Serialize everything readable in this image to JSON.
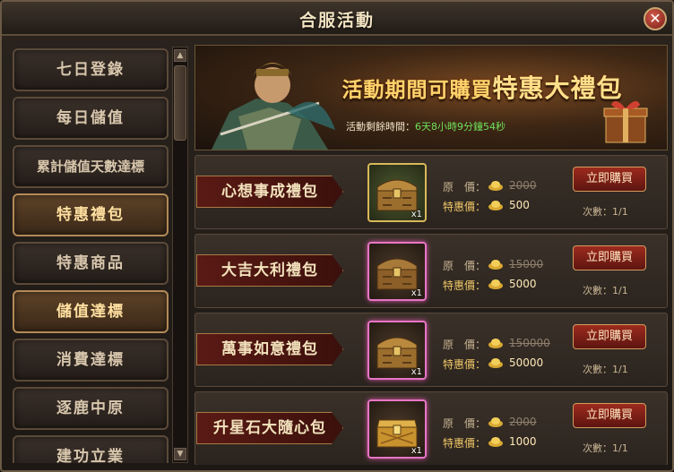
{
  "window": {
    "title": "合服活動"
  },
  "sidebar": {
    "items": [
      {
        "label": "七日登錄",
        "active": false
      },
      {
        "label": "每日儲值",
        "active": false
      },
      {
        "label": "累計儲值天數達標",
        "active": false
      },
      {
        "label": "特惠禮包",
        "active": true
      },
      {
        "label": "特惠商品",
        "active": false
      },
      {
        "label": "儲值達標",
        "active": true
      },
      {
        "label": "消費達標",
        "active": false
      },
      {
        "label": "逐鹿中原",
        "active": false
      },
      {
        "label": "建功立業",
        "active": false
      }
    ]
  },
  "banner": {
    "headline_prefix": "活動期間可購買",
    "headline_main": "特惠大禮包",
    "countdown_label": "活動剩餘時間：",
    "countdown_value": "6天8小時9分鐘54秒"
  },
  "labels": {
    "original_price": "原　價：",
    "sale_price": "特惠價：",
    "buy": "立即購買",
    "times_prefix": "次數："
  },
  "packs": [
    {
      "name": "心想事成禮包",
      "quantity": "x1",
      "original_price": "2000",
      "sale_price": "500",
      "times": "1/1",
      "icon": "treasure-chest-icon"
    },
    {
      "name": "大吉大利禮包",
      "quantity": "x1",
      "original_price": "15000",
      "sale_price": "5000",
      "times": "1/1",
      "icon": "treasure-chest-icon"
    },
    {
      "name": "萬事如意禮包",
      "quantity": "x1",
      "original_price": "150000",
      "sale_price": "50000",
      "times": "1/1",
      "icon": "treasure-chest-icon"
    },
    {
      "name": "升星石大隨心包",
      "quantity": "x1",
      "original_price": "2000",
      "sale_price": "1000",
      "times": "1/1",
      "icon": "gold-chest-icon"
    }
  ],
  "colors": {
    "accent_gold": "#ffd46b",
    "button_red": "#9c2a1e",
    "timer_green": "#6fe05a"
  }
}
